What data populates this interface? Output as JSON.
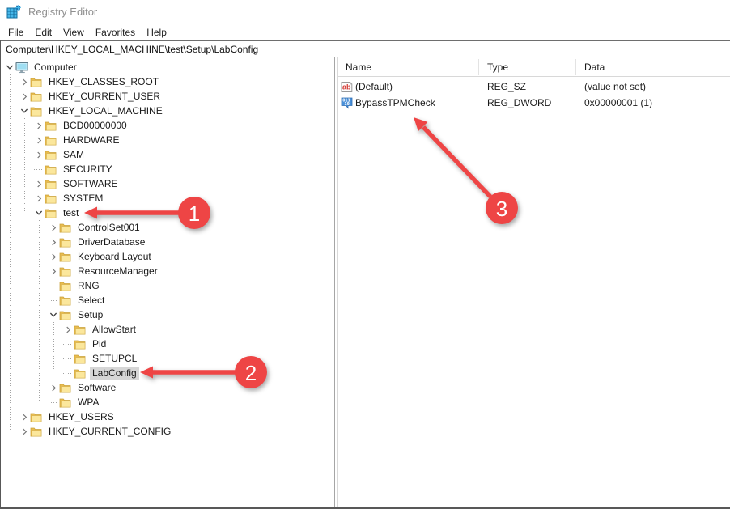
{
  "window": {
    "title": "Registry Editor"
  },
  "menu": {
    "items": [
      "File",
      "Edit",
      "View",
      "Favorites",
      "Help"
    ]
  },
  "address_bar": {
    "value": "Computer\\HKEY_LOCAL_MACHINE\\test\\Setup\\LabConfig"
  },
  "tree": {
    "items": [
      {
        "label": "Computer",
        "level": 0,
        "state": "expanded",
        "icon": "computer",
        "selected": false
      },
      {
        "label": "HKEY_CLASSES_ROOT",
        "level": 1,
        "state": "collapsed",
        "icon": "folder",
        "selected": false
      },
      {
        "label": "HKEY_CURRENT_USER",
        "level": 1,
        "state": "collapsed",
        "icon": "folder",
        "selected": false
      },
      {
        "label": "HKEY_LOCAL_MACHINE",
        "level": 1,
        "state": "expanded",
        "icon": "folder",
        "selected": false
      },
      {
        "label": "BCD00000000",
        "level": 2,
        "state": "collapsed",
        "icon": "folder",
        "selected": false
      },
      {
        "label": "HARDWARE",
        "level": 2,
        "state": "collapsed",
        "icon": "folder",
        "selected": false
      },
      {
        "label": "SAM",
        "level": 2,
        "state": "collapsed",
        "icon": "folder",
        "selected": false
      },
      {
        "label": "SECURITY",
        "level": 2,
        "state": "leaf",
        "icon": "folder",
        "selected": false
      },
      {
        "label": "SOFTWARE",
        "level": 2,
        "state": "collapsed",
        "icon": "folder",
        "selected": false
      },
      {
        "label": "SYSTEM",
        "level": 2,
        "state": "collapsed",
        "icon": "folder",
        "selected": false
      },
      {
        "label": "test",
        "level": 2,
        "state": "expanded",
        "icon": "folder",
        "selected": false
      },
      {
        "label": "ControlSet001",
        "level": 3,
        "state": "collapsed",
        "icon": "folder",
        "selected": false
      },
      {
        "label": "DriverDatabase",
        "level": 3,
        "state": "collapsed",
        "icon": "folder",
        "selected": false
      },
      {
        "label": "Keyboard Layout",
        "level": 3,
        "state": "collapsed",
        "icon": "folder",
        "selected": false
      },
      {
        "label": "ResourceManager",
        "level": 3,
        "state": "collapsed",
        "icon": "folder",
        "selected": false
      },
      {
        "label": "RNG",
        "level": 3,
        "state": "leaf",
        "icon": "folder",
        "selected": false
      },
      {
        "label": "Select",
        "level": 3,
        "state": "leaf",
        "icon": "folder",
        "selected": false
      },
      {
        "label": "Setup",
        "level": 3,
        "state": "expanded",
        "icon": "folder",
        "selected": false
      },
      {
        "label": "AllowStart",
        "level": 4,
        "state": "collapsed",
        "icon": "folder",
        "selected": false
      },
      {
        "label": "Pid",
        "level": 4,
        "state": "leaf",
        "icon": "folder",
        "selected": false
      },
      {
        "label": "SETUPCL",
        "level": 4,
        "state": "leaf",
        "icon": "folder",
        "selected": false
      },
      {
        "label": "LabConfig",
        "level": 4,
        "state": "leaf",
        "icon": "folder",
        "selected": true
      },
      {
        "label": "Software",
        "level": 3,
        "state": "collapsed",
        "icon": "folder",
        "selected": false
      },
      {
        "label": "WPA",
        "level": 3,
        "state": "leaf",
        "icon": "folder",
        "selected": false
      },
      {
        "label": "HKEY_USERS",
        "level": 1,
        "state": "collapsed",
        "icon": "folder",
        "selected": false
      },
      {
        "label": "HKEY_CURRENT_CONFIG",
        "level": 1,
        "state": "collapsed",
        "icon": "folder",
        "selected": false
      }
    ]
  },
  "values_panel": {
    "columns": [
      "Name",
      "Type",
      "Data"
    ],
    "rows": [
      {
        "icon": "string-value-icon",
        "name": "(Default)",
        "type": "REG_SZ",
        "data": "(value not set)"
      },
      {
        "icon": "dword-value-icon",
        "name": "BypassTPMCheck",
        "type": "REG_DWORD",
        "data": "0x00000001 (1)"
      }
    ]
  },
  "annotations": {
    "color": "#ee4545",
    "badges": [
      "1",
      "2",
      "3"
    ]
  },
  "colors": {
    "folder": "#f7d97e",
    "selection_inactive": "#d6d6d6",
    "frame_border": "#585858"
  }
}
